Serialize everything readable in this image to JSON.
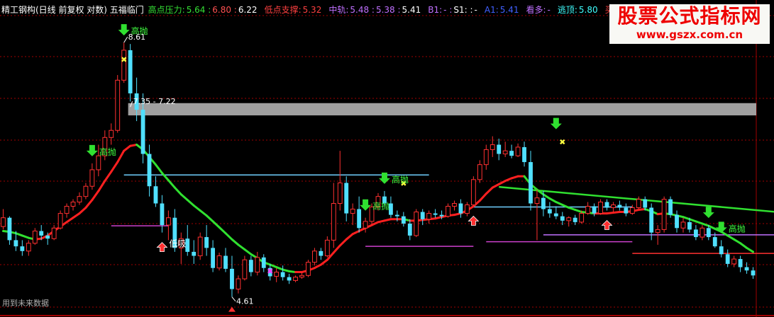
{
  "header": {
    "title": "精工钢构(日线 前复权 对数) 五福临门",
    "title_color": "#ffffff",
    "items": [
      {
        "label": "高点压力:",
        "color": "#35e035",
        "values": [
          "5.64",
          "6.80",
          "6.22"
        ],
        "value_colors": [
          "#35e035",
          "#ff5050",
          "#ffffff"
        ]
      },
      {
        "label": "低点支撑:",
        "color": "#ff4040",
        "values": [
          "5.32"
        ],
        "value_colors": [
          "#ff4040"
        ]
      },
      {
        "label": "中轨:",
        "color": "#c070ff",
        "values": [
          "5.48",
          "5.38",
          "5.41"
        ],
        "value_colors": [
          "#c070ff",
          "#c070ff",
          "#ffffff"
        ]
      },
      {
        "label": "B1:",
        "color": "#c070ff",
        "values": [
          "-",
          "S1:",
          "-"
        ],
        "value_colors": [
          "#c070ff",
          "#ffffff",
          "#ffffff"
        ]
      },
      {
        "label": "A1:",
        "color": "#4060ff",
        "values": [
          "5.41"
        ],
        "value_colors": [
          "#4060ff"
        ]
      },
      {
        "label": "看多:",
        "color": "#c070ff",
        "values": [
          "-"
        ],
        "value_colors": [
          "#c070ff"
        ]
      },
      {
        "label": "逃顶:",
        "color": "#40ffff",
        "values": [
          "5.80"
        ],
        "value_colors": [
          "#40ffff"
        ]
      },
      {
        "label": "买入持股",
        "color": "#ff4040",
        "values": [],
        "value_colors": []
      }
    ]
  },
  "watermark": {
    "title": "股票公式指标网",
    "url": "www.gszx.com.cn"
  },
  "footer": "用到未来数据",
  "chart_data": {
    "type": "candlestick",
    "scale": "log",
    "ylim": [
      4.45,
      9.2
    ],
    "colors": {
      "up": "#ff3030",
      "down": "#50e0ff",
      "ma_up": "#ff2020",
      "ma_down": "#30e030",
      "background": "#000000",
      "grid": "#a00000"
    },
    "candles": [
      [
        5.48,
        5.72,
        5.44,
        5.6
      ],
      [
        5.6,
        5.62,
        5.24,
        5.3
      ],
      [
        5.3,
        5.42,
        5.16,
        5.22
      ],
      [
        5.22,
        5.3,
        5.1,
        5.16
      ],
      [
        5.16,
        5.3,
        5.1,
        5.26
      ],
      [
        5.26,
        5.46,
        5.24,
        5.42
      ],
      [
        5.42,
        5.5,
        5.3,
        5.36
      ],
      [
        5.36,
        5.4,
        5.24,
        5.32
      ],
      [
        5.32,
        5.5,
        5.3,
        5.46
      ],
      [
        5.46,
        5.7,
        5.44,
        5.66
      ],
      [
        5.66,
        5.8,
        5.6,
        5.76
      ],
      [
        5.76,
        5.86,
        5.7,
        5.82
      ],
      [
        5.82,
        5.96,
        5.78,
        5.9
      ],
      [
        5.9,
        6.1,
        5.86,
        6.05
      ],
      [
        6.05,
        6.4,
        6.0,
        6.3
      ],
      [
        6.3,
        6.7,
        6.2,
        6.52
      ],
      [
        6.52,
        6.94,
        6.45,
        6.82
      ],
      [
        6.82,
        7.06,
        6.7,
        6.94
      ],
      [
        6.94,
        7.95,
        6.9,
        7.85
      ],
      [
        7.85,
        8.61,
        7.8,
        8.45
      ],
      [
        8.45,
        8.58,
        7.45,
        7.6
      ],
      [
        7.6,
        7.9,
        7.1,
        7.3
      ],
      [
        7.3,
        7.6,
        6.4,
        6.55
      ],
      [
        6.55,
        6.7,
        5.9,
        6.05
      ],
      [
        6.05,
        6.2,
        5.75,
        5.8
      ],
      [
        5.8,
        5.92,
        5.4,
        5.5
      ],
      [
        5.5,
        5.7,
        5.3,
        5.6
      ],
      [
        5.6,
        5.72,
        5.15,
        5.2
      ],
      [
        5.2,
        5.4,
        5.0,
        5.32
      ],
      [
        5.32,
        5.5,
        5.1,
        5.15
      ],
      [
        5.15,
        5.3,
        5.0,
        5.1
      ],
      [
        5.1,
        5.4,
        5.05,
        5.34
      ],
      [
        5.34,
        5.5,
        5.1,
        5.2
      ],
      [
        5.2,
        5.3,
        4.9,
        4.95
      ],
      [
        4.95,
        5.14,
        4.92,
        5.1
      ],
      [
        5.1,
        5.2,
        4.9,
        4.94
      ],
      [
        4.94,
        5.1,
        4.61,
        4.7
      ],
      [
        4.7,
        4.86,
        4.65,
        4.82
      ],
      [
        4.82,
        5.1,
        4.8,
        5.05
      ],
      [
        5.05,
        5.1,
        4.85,
        4.9
      ],
      [
        4.9,
        5.15,
        4.86,
        5.08
      ],
      [
        5.08,
        5.12,
        4.9,
        4.95
      ],
      [
        4.95,
        5.0,
        4.8,
        4.85
      ],
      [
        4.85,
        4.95,
        4.78,
        4.9
      ],
      [
        4.9,
        4.98,
        4.8,
        4.84
      ],
      [
        4.84,
        4.88,
        4.76,
        4.8
      ],
      [
        4.8,
        4.86,
        4.78,
        4.84
      ],
      [
        4.84,
        4.9,
        4.82,
        4.86
      ],
      [
        4.86,
        5.05,
        4.84,
        5.02
      ],
      [
        5.02,
        5.2,
        4.98,
        5.16
      ],
      [
        5.16,
        5.2,
        5.05,
        5.1
      ],
      [
        5.1,
        5.35,
        5.08,
        5.3
      ],
      [
        5.3,
        6.1,
        5.2,
        5.8
      ],
      [
        5.8,
        6.6,
        5.7,
        6.1
      ],
      [
        6.1,
        6.2,
        5.55,
        5.66
      ],
      [
        5.66,
        5.8,
        5.5,
        5.72
      ],
      [
        5.72,
        5.9,
        5.4,
        5.46
      ],
      [
        5.46,
        5.6,
        5.4,
        5.55
      ],
      [
        5.55,
        5.8,
        5.5,
        5.75
      ],
      [
        5.75,
        5.95,
        5.7,
        5.9
      ],
      [
        5.9,
        5.98,
        5.75,
        5.8
      ],
      [
        5.8,
        5.9,
        5.6,
        5.64
      ],
      [
        5.64,
        5.7,
        5.55,
        5.62
      ],
      [
        5.62,
        5.68,
        5.48,
        5.52
      ],
      [
        5.52,
        5.58,
        5.3,
        5.36
      ],
      [
        5.36,
        5.72,
        5.34,
        5.68
      ],
      [
        5.68,
        5.72,
        5.5,
        5.58
      ],
      [
        5.58,
        5.7,
        5.52,
        5.66
      ],
      [
        5.66,
        5.72,
        5.6,
        5.64
      ],
      [
        5.64,
        5.7,
        5.58,
        5.62
      ],
      [
        5.62,
        5.8,
        5.6,
        5.76
      ],
      [
        5.76,
        5.84,
        5.7,
        5.8
      ],
      [
        5.8,
        5.86,
        5.6,
        5.66
      ],
      [
        5.66,
        5.82,
        5.62,
        5.78
      ],
      [
        5.78,
        6.2,
        5.76,
        6.15
      ],
      [
        6.15,
        6.45,
        6.1,
        6.38
      ],
      [
        6.38,
        6.7,
        6.3,
        6.62
      ],
      [
        6.62,
        6.84,
        6.5,
        6.7
      ],
      [
        6.7,
        6.8,
        6.45,
        6.55
      ],
      [
        6.55,
        6.75,
        6.5,
        6.6
      ],
      [
        6.6,
        6.7,
        6.48,
        6.52
      ],
      [
        6.52,
        6.72,
        6.5,
        6.66
      ],
      [
        6.66,
        6.75,
        6.35,
        6.42
      ],
      [
        6.42,
        6.6,
        5.7,
        5.8
      ],
      [
        5.8,
        6.0,
        5.3,
        5.88
      ],
      [
        5.88,
        5.98,
        5.62,
        5.72
      ],
      [
        5.72,
        5.82,
        5.6,
        5.66
      ],
      [
        5.66,
        5.76,
        5.58,
        5.62
      ],
      [
        5.62,
        5.68,
        5.5,
        5.56
      ],
      [
        5.56,
        5.62,
        5.48,
        5.6
      ],
      [
        5.6,
        5.64,
        5.5,
        5.54
      ],
      [
        5.54,
        5.7,
        5.52,
        5.66
      ],
      [
        5.66,
        5.82,
        5.64,
        5.76
      ],
      [
        5.76,
        5.8,
        5.62,
        5.66
      ],
      [
        5.66,
        5.86,
        5.64,
        5.82
      ],
      [
        5.82,
        5.86,
        5.7,
        5.74
      ],
      [
        5.74,
        5.82,
        5.68,
        5.78
      ],
      [
        5.78,
        5.84,
        5.7,
        5.74
      ],
      [
        5.74,
        5.8,
        5.62,
        5.66
      ],
      [
        5.66,
        5.78,
        5.64,
        5.74
      ],
      [
        5.74,
        5.9,
        5.72,
        5.86
      ],
      [
        5.86,
        5.9,
        5.7,
        5.74
      ],
      [
        5.74,
        5.8,
        5.3,
        5.4
      ],
      [
        5.4,
        5.5,
        5.24,
        5.44
      ],
      [
        5.44,
        5.9,
        5.4,
        5.86
      ],
      [
        5.86,
        5.9,
        5.6,
        5.64
      ],
      [
        5.64,
        5.7,
        5.4,
        5.46
      ],
      [
        5.46,
        5.6,
        5.4,
        5.54
      ],
      [
        5.54,
        5.6,
        5.4,
        5.44
      ],
      [
        5.44,
        5.5,
        5.3,
        5.34
      ],
      [
        5.34,
        5.5,
        5.3,
        5.46
      ],
      [
        5.46,
        5.5,
        5.3,
        5.34
      ],
      [
        5.34,
        5.4,
        5.2,
        5.22
      ],
      [
        5.22,
        5.3,
        5.08,
        5.12
      ],
      [
        5.12,
        5.18,
        4.96,
        5.0
      ],
      [
        5.0,
        5.1,
        4.96,
        5.06
      ],
      [
        5.06,
        5.1,
        4.9,
        4.96
      ],
      [
        4.96,
        5.02,
        4.88,
        4.92
      ],
      [
        4.92,
        4.96,
        4.82,
        4.86
      ]
    ],
    "ma_line": [
      5.42,
      5.41,
      5.39,
      5.36,
      5.33,
      5.31,
      5.32,
      5.36,
      5.42,
      5.48,
      5.54,
      5.6,
      5.66,
      5.74,
      5.85,
      5.98,
      6.13,
      6.27,
      6.42,
      6.6,
      6.68,
      6.7,
      6.62,
      6.5,
      6.38,
      6.25,
      6.14,
      6.03,
      5.93,
      5.85,
      5.77,
      5.7,
      5.63,
      5.55,
      5.47,
      5.39,
      5.31,
      5.24,
      5.18,
      5.12,
      5.07,
      5.02,
      4.99,
      4.96,
      4.93,
      4.91,
      4.9,
      4.9,
      4.92,
      4.95,
      4.99,
      5.05,
      5.14,
      5.23,
      5.31,
      5.38,
      5.42,
      5.46,
      5.5,
      5.54,
      5.56,
      5.58,
      5.58,
      5.58,
      5.56,
      5.56,
      5.57,
      5.58,
      5.59,
      5.61,
      5.63,
      5.64,
      5.66,
      5.7,
      5.76,
      5.84,
      5.94,
      6.03,
      6.08,
      6.13,
      6.17,
      6.2,
      6.2,
      6.08,
      6.0,
      5.93,
      5.87,
      5.82,
      5.78,
      5.74,
      5.71,
      5.68,
      5.67,
      5.66,
      5.66,
      5.66,
      5.67,
      5.68,
      5.68,
      5.69,
      5.71,
      5.72,
      5.69,
      5.65,
      5.66,
      5.65,
      5.63,
      5.61,
      5.58,
      5.55,
      5.52,
      5.49,
      5.45,
      5.41,
      5.36,
      5.31,
      5.26,
      5.2,
      5.15
    ],
    "upper_line": [
      [
        78,
        6.04
      ],
      [
        133,
        5.59
      ]
    ],
    "levels": [
      {
        "kind": "resistance",
        "from": 19,
        "to": 67,
        "value": 6.22,
        "color": "#6fd0ff"
      },
      {
        "kind": "resistance",
        "from": 74,
        "to": 99,
        "value": 5.75,
        "color": "#6fd0ff"
      },
      {
        "kind": "support",
        "from": 17,
        "to": 26,
        "value": 5.49,
        "color": "#cc40cc"
      },
      {
        "kind": "support",
        "from": 57,
        "to": 74,
        "value": 5.22,
        "color": "#cc40cc"
      },
      {
        "kind": "support",
        "from": 76,
        "to": 99,
        "value": 5.28,
        "color": "#cc40cc"
      },
      {
        "kind": "support",
        "from": 99,
        "to": 133,
        "value": 5.13,
        "color": "#ff3030"
      },
      {
        "kind": "middle",
        "from": 85,
        "to": 133,
        "value": 5.37,
        "color": "#c070ff"
      }
    ],
    "high_band": [
      7.2,
      7.42
    ],
    "annotations": [
      {
        "i": 19,
        "text": "8.61",
        "price": 8.61,
        "pos": "above"
      },
      {
        "i": 20,
        "text": "7.35 - 7.22",
        "price": 7.35,
        "pos": "right"
      },
      {
        "i": 36,
        "text": "4.61",
        "price": 4.61,
        "pos": "below"
      }
    ],
    "sell_signals": [
      {
        "i": 19,
        "label": "高抛"
      },
      {
        "i": 14,
        "label": "高抛"
      },
      {
        "i": 60,
        "label": "高抛"
      },
      {
        "i": 57,
        "label": "高抛"
      },
      {
        "i": 87,
        "label": "",
        "price": 6.84
      },
      {
        "i": 113,
        "label": "高抛"
      },
      {
        "i": 111,
        "label": ""
      }
    ],
    "low_signals": [
      {
        "i": 25,
        "label": "低吸"
      }
    ],
    "buy_arrows": [
      25,
      74,
      95
    ],
    "star_marks": [
      {
        "i": 19,
        "price": 8.2
      },
      {
        "i": 63,
        "price": 6.05
      },
      {
        "i": 88,
        "price": 6.7
      },
      {
        "i": 42,
        "price": 4.88
      }
    ]
  }
}
